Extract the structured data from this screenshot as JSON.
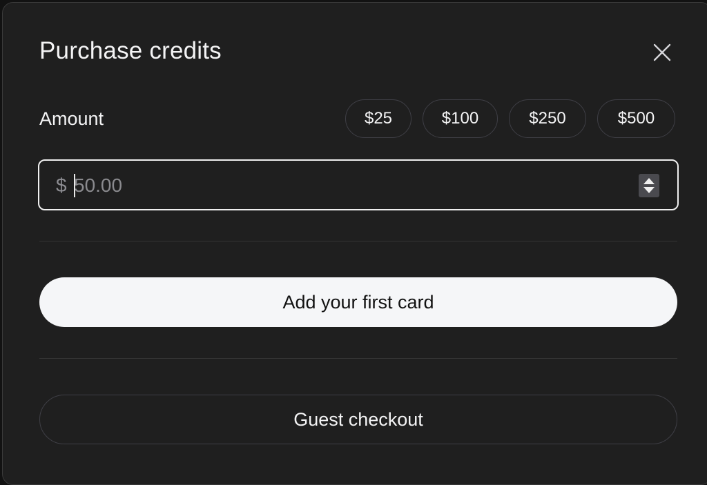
{
  "modal": {
    "title": "Purchase credits",
    "close_icon": "close-icon"
  },
  "amount": {
    "label": "Amount",
    "presets": [
      "$25",
      "$100",
      "$250",
      "$500"
    ],
    "currency_symbol": "$",
    "value": "",
    "placeholder": "50.00",
    "stepper_icon": "stepper-up-down-icon"
  },
  "actions": {
    "add_card_label": "Add your first card",
    "guest_checkout_label": "Guest checkout"
  },
  "colors": {
    "background": "#1f1f1f",
    "primary_button": "#f5f6f8",
    "text": "#f4f4f5",
    "border": "#3f3f46"
  }
}
